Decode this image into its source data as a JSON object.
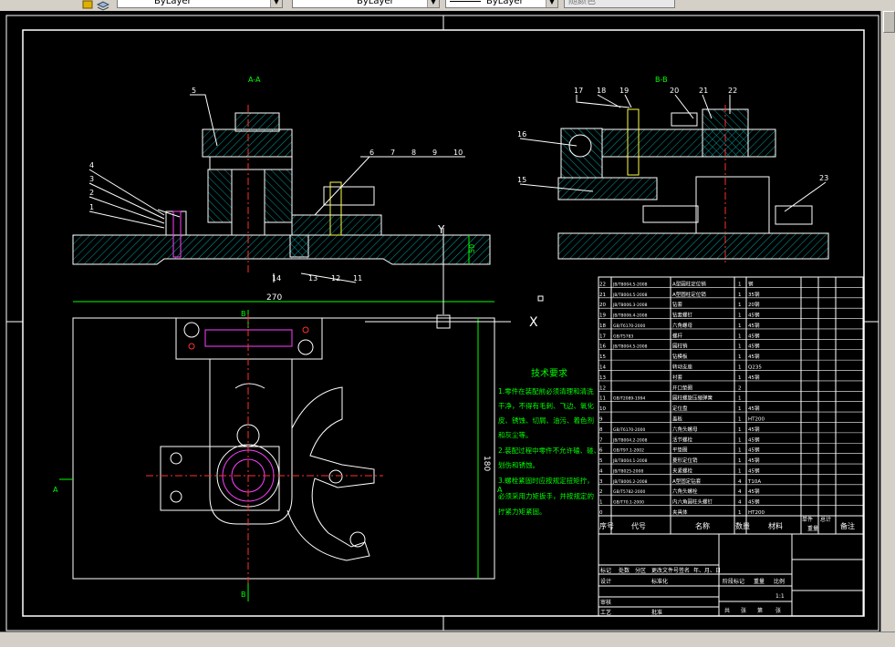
{
  "toolbar": {
    "layer_combo": "ByLayer",
    "linetype_combo": "ByLayer",
    "lineweight_combo": "ByLayer",
    "plotstyle_combo": "随颜色"
  },
  "views": {
    "section_a": "A-A",
    "section_b": "B-B",
    "dim_width": "270",
    "dim_height": "180",
    "dim_h_small": "50",
    "label_b_top": "B",
    "label_b_bottom": "B",
    "label_a_left": "A",
    "label_a_right": "A"
  },
  "callouts_a": [
    "5",
    "4",
    "3",
    "2",
    "1",
    "6",
    "7",
    "8",
    "9",
    "10",
    "14",
    "13",
    "12",
    "11"
  ],
  "callouts_b": [
    "17",
    "18",
    "19",
    "20",
    "21",
    "22",
    "16",
    "15",
    "23"
  ],
  "tech": {
    "title": "技术要求",
    "lines": [
      "1.零件在装配前必须清理和清洗",
      "干净，不得有毛刺、飞边、氧化",
      "皮、锈蚀、切屑、油污、着色剂",
      "和灰尘等。",
      "2.装配过程中零件不允许磕、碰、",
      "划伤和锈蚀。",
      "3.螺栓紧固时应按规定扭矩拧，",
      "必须采用力矩扳手，并按规定的",
      "拧紧力矩紧固。"
    ]
  },
  "bom": {
    "header": [
      "序号",
      "代号",
      "名称",
      "数量",
      "材料",
      "单件",
      "总计",
      "备注"
    ],
    "header_mass": "重量",
    "rows": [
      [
        "22",
        "JB/T8004.5-2008",
        "A型圆柱定位销",
        "1",
        "钢",
        ""
      ],
      [
        "21",
        "JB/T8004.5-2008",
        "A型圆柱定位销",
        "1",
        "35钢",
        ""
      ],
      [
        "20",
        "JB/T8006.3-2008",
        "钻套",
        "1",
        "20钢",
        ""
      ],
      [
        "19",
        "JB/T8006.4-2008",
        "钻套螺钉",
        "1",
        "45钢",
        ""
      ],
      [
        "18",
        "GB/T6170-2000",
        "六角螺母",
        "1",
        "45钢",
        ""
      ],
      [
        "17",
        "GB/T5783",
        "螺杆",
        "1",
        "45钢",
        ""
      ],
      [
        "16",
        "JB/T8004.5-2008",
        "圆柱销",
        "1",
        "45钢",
        ""
      ],
      [
        "15",
        "",
        "钻模板",
        "1",
        "45钢",
        ""
      ],
      [
        "14",
        "",
        "转动支座",
        "1",
        "Q235",
        ""
      ],
      [
        "13",
        "",
        "衬套",
        "1",
        "45钢",
        ""
      ],
      [
        "12",
        "",
        "开口垫圈",
        "2",
        "",
        ""
      ],
      [
        "11",
        "GB/T2089-1994",
        "圆柱螺旋压缩弹簧",
        "1",
        "",
        ""
      ],
      [
        "10",
        "",
        "定位盘",
        "1",
        "45钢",
        ""
      ],
      [
        "9",
        "",
        "盖板",
        "1",
        "HT200",
        ""
      ],
      [
        "8",
        "GB/T6170-2000",
        "六角头螺母",
        "1",
        "45钢",
        ""
      ],
      [
        "7",
        "JB/T8004.2-2008",
        "活节螺栓",
        "1",
        "45钢",
        ""
      ],
      [
        "6",
        "GB/T97.1-2002",
        "平垫圈",
        "1",
        "45钢",
        ""
      ],
      [
        "5",
        "JB/T8004.1-2008",
        "菱形定位销",
        "1",
        "45钢",
        ""
      ],
      [
        "4",
        "JB/T8025-2008",
        "夹紧螺栓",
        "1",
        "45钢",
        ""
      ],
      [
        "3",
        "JB/T8006.2-2008",
        "A型固定钻套",
        "4",
        "T10A",
        ""
      ],
      [
        "2",
        "GB/T5782-2000",
        "六角头螺栓",
        "4",
        "45钢",
        ""
      ],
      [
        "1",
        "GB/T70.1-2000",
        "内六角圆柱头螺钉",
        "4",
        "45钢",
        ""
      ],
      [
        "0",
        "",
        "夹具体",
        "1",
        "HT200",
        ""
      ]
    ]
  },
  "title_block": {
    "r1": [
      "标记",
      "处数",
      "分区",
      "更改文件号",
      "签名",
      "年、月、日"
    ],
    "r2": [
      "设计",
      "",
      "标准化",
      "",
      "",
      "",
      "阶段标记",
      "重量",
      "比例"
    ],
    "scale": "1:1",
    "r3": [
      "审核"
    ],
    "r4": [
      "工艺",
      "",
      "批准",
      "",
      "共",
      "张",
      "第",
      "张"
    ]
  },
  "colors": {
    "background": "#000000",
    "geometry": "#ffffff",
    "hatch": "#00c8c8",
    "dimension": "#00ff00",
    "centerline": "#ff3030",
    "highlight": "#ff40ff",
    "bolt": "#ffff40"
  }
}
